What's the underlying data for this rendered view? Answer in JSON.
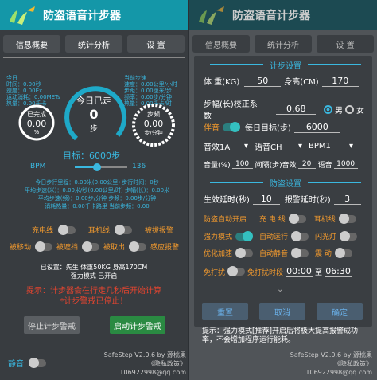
{
  "app": {
    "title": "防盗语音计步器",
    "version": "SafeStep V2.0.6 by 源桃果",
    "privacy": "《隐私政策》",
    "email": "106922998@qq.com"
  },
  "tabs": [
    "信息概要",
    "统计分析",
    "设  置"
  ],
  "overview": {
    "today_label": "今日",
    "today_time": "时间：0.00秒",
    "today_speed": "速度：0.00Ex",
    "today_distance": "运动消耗：0.00METs",
    "today_heat": "热量：0.00千卡",
    "now_label": "当前步速",
    "now_speed": "速度：0.00公里/小时",
    "now_distance": "步距：0.00厘米/步",
    "now_freq": "频率：0.00步/分钟",
    "now_heat": "热量：0.00千卡/时",
    "done_label": "已完成",
    "done_value": "0.00",
    "done_unit": "%",
    "walked_label": "今日已走",
    "walked_value": "0",
    "walked_unit": "步",
    "freq_label": "步频",
    "freq_value": "0.00",
    "freq_unit": "步/分钟",
    "target": "目标：6000步",
    "bpm_label": "BPM",
    "bpm_value": "136",
    "bpm_fraction": 0.42,
    "stats": [
      "今日步行里程：0.00米(0.00公里)  步行时间：0秒",
      "平均步速(米)：0.00米/秒(0.00公里/时)  步幅(长)：0.00米",
      "平均步速(频)：0.00步/分钟  步频：0.00步/分钟",
      "消耗热量：0.00千卡路里  当前步频：0.00"
    ],
    "switches": [
      {
        "label": "充电线",
        "on": false
      },
      {
        "label": "耳机线",
        "on": false
      },
      {
        "label": "被拔报警",
        "on": false
      },
      {
        "label": "被移动",
        "on": false
      },
      {
        "label": "被遮挡",
        "on": false
      },
      {
        "label": "被取出",
        "on": false
      },
      {
        "label": "感应报警",
        "on": false
      }
    ],
    "settings_line1": "已设置：先生 体重50KG 身高170CM",
    "settings_line2": "强力模式 已开启",
    "hint1": "提示：计步器会在行走几秒后开始计算",
    "hint2": "*计步警戒已停止！",
    "stop_btn": "停止计步警戒",
    "start_btn": "启动计步警戒",
    "mute_label": "静音"
  },
  "settings": {
    "section1": "计步设置",
    "weight_label": "体  重(KG)",
    "weight": "50",
    "height_label": "身高(CM)",
    "height": "170",
    "stride_label": "步幅(长)校正系数",
    "stride": "0.68",
    "male": "男",
    "female": "女",
    "companion_label": "伴音",
    "goal_label": "每日目标(步)",
    "goal": "6000",
    "effect": "音效1A",
    "voice": "语音CH",
    "bpm": "BPM1",
    "vol_label": "音量(%)",
    "vol": "100",
    "interval_label": "间隔(步)音效",
    "interval": "20",
    "voice_label": "语音",
    "voice_val": "1000",
    "section2": "防盗设置",
    "delay_label": "生效延时(秒)",
    "delay": "10",
    "alarm_delay_label": "报警延时(秒)",
    "alarm_delay": "3",
    "auto_label": "防盗自动开启",
    "charge": "充 电 线",
    "earphone": "耳机线",
    "power": "强力模式",
    "autorun": "自动运行",
    "flash": "闪光灯",
    "optimize": "优化加速",
    "automute": "自动静音",
    "vibrate": "震  动",
    "dnd": "免打扰",
    "dnd_time_label": "免打扰时段",
    "dnd_start": "00:00",
    "dnd_to": "至",
    "dnd_end": "06:30",
    "reset": "重置",
    "cancel": "取消",
    "confirm": "确定",
    "hint": "提示：强力模式[推荐]开启后将极大提高报警成功率，不会增加程序运行能耗。"
  }
}
